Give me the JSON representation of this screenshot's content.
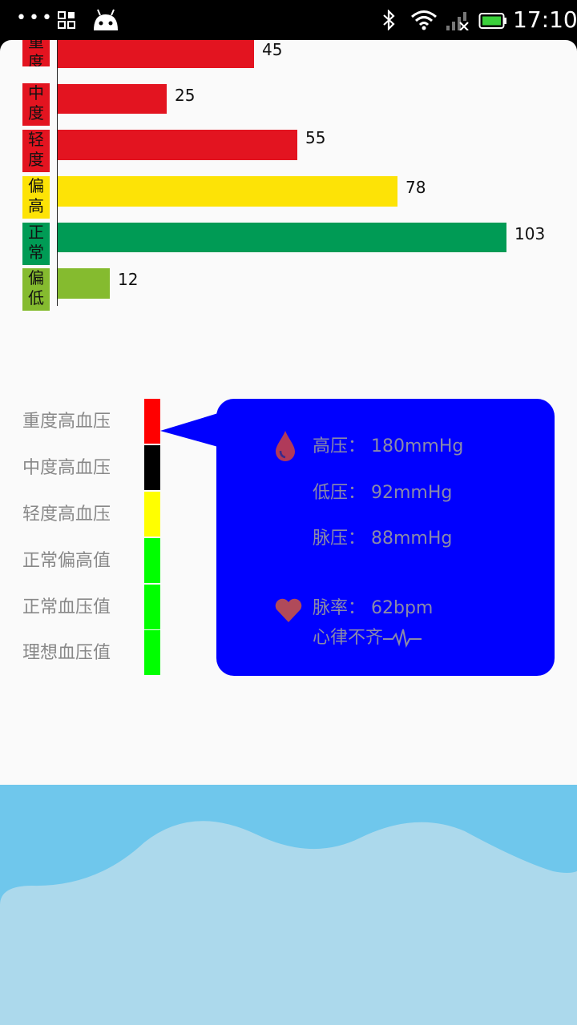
{
  "status_bar": {
    "time": "17:10",
    "icons": [
      "more-dots-icon",
      "grid-icon",
      "android-icon",
      "bluetooth-icon",
      "wifi-icon",
      "signal-icon",
      "battery-icon"
    ]
  },
  "chart_data": {
    "type": "bar",
    "orientation": "horizontal",
    "categories": [
      "重度",
      "中度",
      "轻度",
      "偏高",
      "正常",
      "偏低"
    ],
    "values": [
      45,
      25,
      55,
      78,
      103,
      12
    ],
    "bar_colors": [
      "#e31420",
      "#e31420",
      "#e31420",
      "#fde306",
      "#009b55",
      "#85bb2f"
    ],
    "label_colors": [
      "#e31420",
      "#e31420",
      "#e31420",
      "#fde306",
      "#009b55",
      "#85bb2f"
    ],
    "grid": false
  },
  "legend": {
    "items": [
      {
        "label": "重度高血压",
        "color": "#ff0000"
      },
      {
        "label": "中度高血压",
        "color": "#000000"
      },
      {
        "label": "轻度高血压",
        "color": "#ffff00"
      },
      {
        "label": "正常偏高值",
        "color": "#00ff00"
      },
      {
        "label": "正常血压值",
        "color": "#00ff00"
      },
      {
        "label": "理想血压值",
        "color": "#00ff00"
      }
    ]
  },
  "info": {
    "bubble_color": "#0000ff",
    "systolic": "高压： 180mmHg",
    "diastolic": "低压： 92mmHg",
    "pulse_pressure": "脉压： 88mmHg",
    "pulse_rate": "脉率： 62bpm",
    "rhythm": "心律不齐",
    "icons": [
      "blood-drop-icon",
      "heart-icon",
      "ecg-icon"
    ]
  },
  "footer": {
    "wave_colors": [
      "#6fc7ec",
      "#acd9ec"
    ]
  }
}
